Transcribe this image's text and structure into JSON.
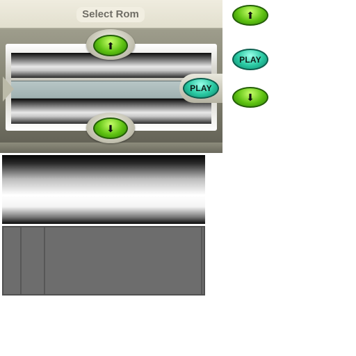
{
  "header": {
    "title": "Select Rom"
  },
  "buttons": {
    "play_label": "PLAY",
    "up_arrow": "⬆",
    "down_arrow": "⬇"
  },
  "sprites": {
    "play_label": "PLAY",
    "up_arrow": "⬆",
    "down_arrow": "⬇"
  },
  "colors": {
    "green_button": "#5ec212",
    "play_button": "#27c7a0",
    "panel_header": "#e2dfce",
    "selection_strip": "#a9b9b9"
  }
}
